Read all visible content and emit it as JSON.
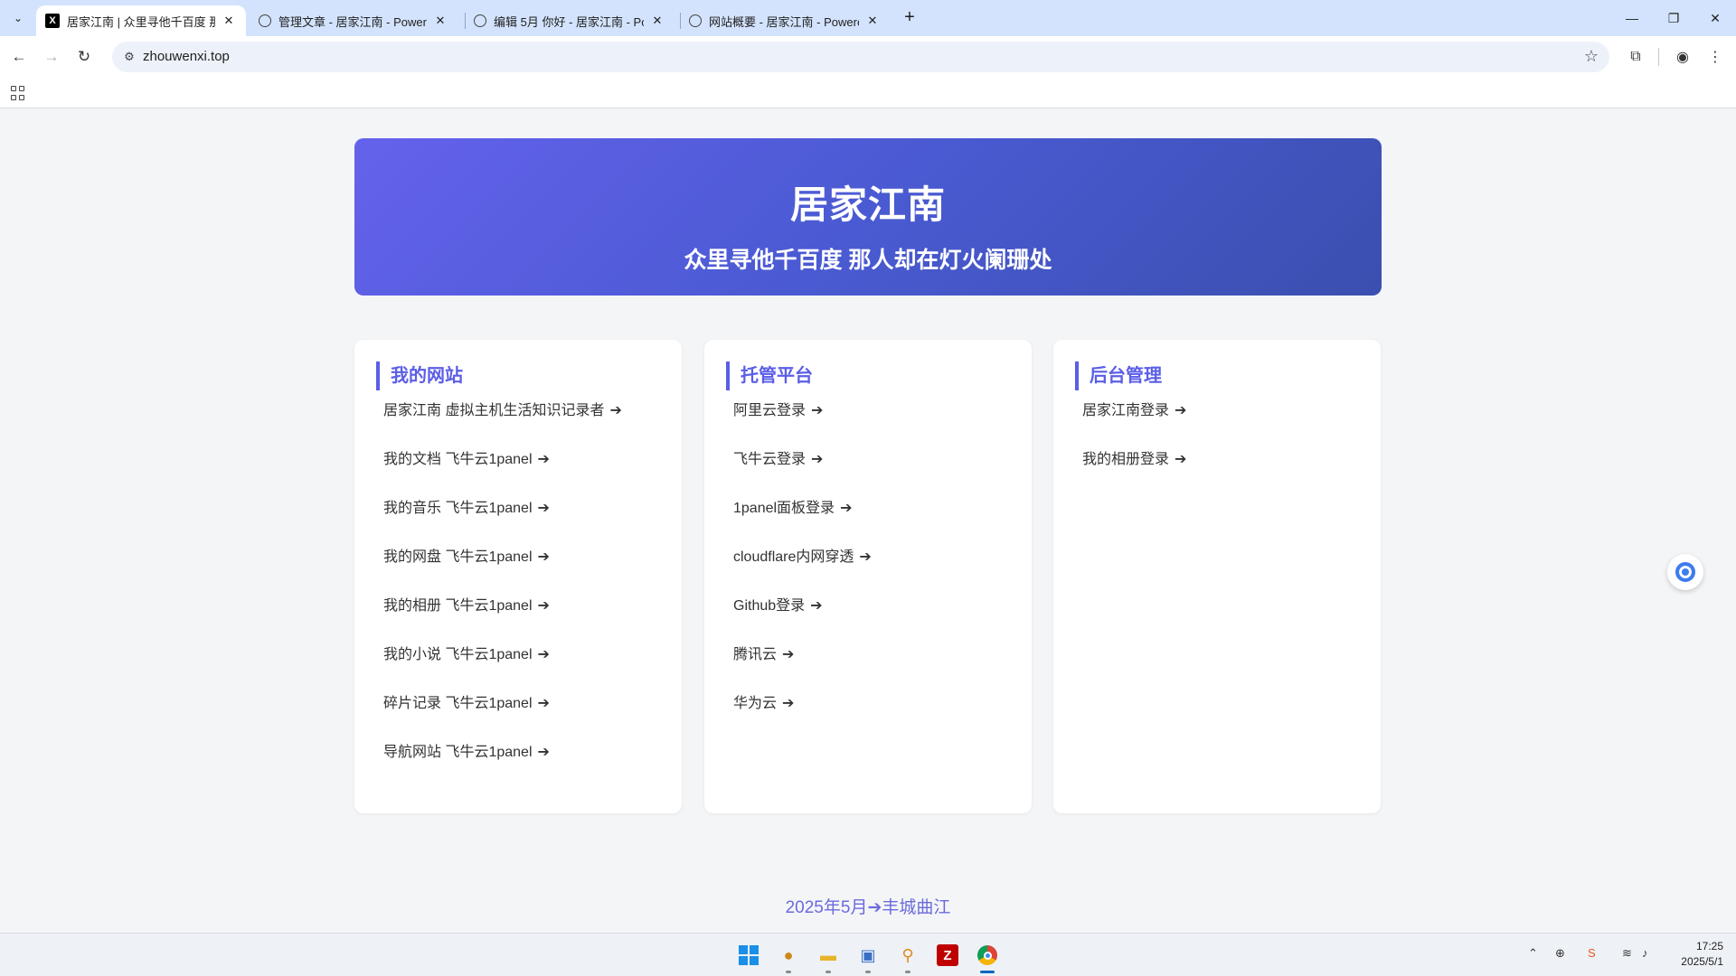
{
  "browser": {
    "tabs": [
      {
        "title": "居家江南 | 众里寻他千百度 那人",
        "icon": "x-logo-icon",
        "active": true
      },
      {
        "title": "管理文章 - 居家江南 - Powere",
        "icon": "globe-icon",
        "active": false
      },
      {
        "title": "编辑 5月 你好 - 居家江南 - Po",
        "icon": "globe-icon",
        "active": false
      },
      {
        "title": "网站概要 - 居家江南 - Powere",
        "icon": "globe-icon",
        "active": false
      }
    ],
    "url": "zhouwenxi.top"
  },
  "hero": {
    "title": "居家江南",
    "subtitle": "众里寻他千百度 那人却在灯火阑珊处"
  },
  "cards": [
    {
      "title": "我的网站",
      "links": [
        "居家江南 虚拟主机生活知识记录者",
        "我的文档 飞牛云1panel",
        "我的音乐 飞牛云1panel",
        "我的网盘 飞牛云1panel",
        "我的相册 飞牛云1panel",
        "我的小说 飞牛云1panel",
        "碎片记录 飞牛云1panel",
        "导航网站 飞牛云1panel"
      ]
    },
    {
      "title": "托管平台",
      "links": [
        "阿里云登录",
        "飞牛云登录",
        "1panel面板登录",
        "cloudflare内网穿透",
        "Github登录",
        "腾讯云",
        "华为云"
      ]
    },
    {
      "title": "后台管理",
      "links": [
        "居家江南登录",
        "我的相册登录"
      ]
    }
  ],
  "arrow": "➔",
  "footer": "2025年5月➔丰城曲江",
  "taskbar": {
    "time": "17:25",
    "date": "2025/5/1"
  },
  "colors": {
    "accent": "#5b5ee6",
    "hero_start": "#6462ec",
    "hero_end": "#3a4faf",
    "tab_strip": "#d3e3fd"
  }
}
